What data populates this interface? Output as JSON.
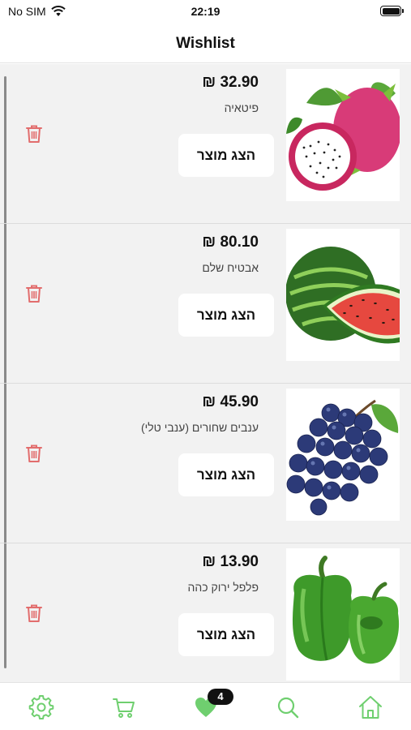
{
  "status_bar": {
    "carrier": "No SIM",
    "time": "22:19"
  },
  "header": {
    "title": "Wishlist"
  },
  "colors": {
    "accent": "#6fcf6f",
    "trash": "#e26d6d",
    "list_bg": "#f2f2f2"
  },
  "wishlist": {
    "items": [
      {
        "price": "32.90 ₪",
        "name": "פיטאיה",
        "view_label": "הצג מוצר",
        "image": "dragon-fruit"
      },
      {
        "price": "80.10 ₪",
        "name": "אבטיח שלם",
        "view_label": "הצג מוצר",
        "image": "watermelon"
      },
      {
        "price": "45.90 ₪",
        "name": "ענבים שחורים (ענבי טלי)",
        "view_label": "הצג מוצר",
        "image": "black-grapes"
      },
      {
        "price": "13.90 ₪",
        "name": "פלפל ירוק כהה",
        "view_label": "הצג מוצר",
        "image": "green-pepper"
      }
    ]
  },
  "tab_bar": {
    "tabs": [
      {
        "icon": "gear-icon"
      },
      {
        "icon": "cart-icon"
      },
      {
        "icon": "heart-icon",
        "badge": "4",
        "active": true
      },
      {
        "icon": "search-icon"
      },
      {
        "icon": "home-icon"
      }
    ]
  }
}
